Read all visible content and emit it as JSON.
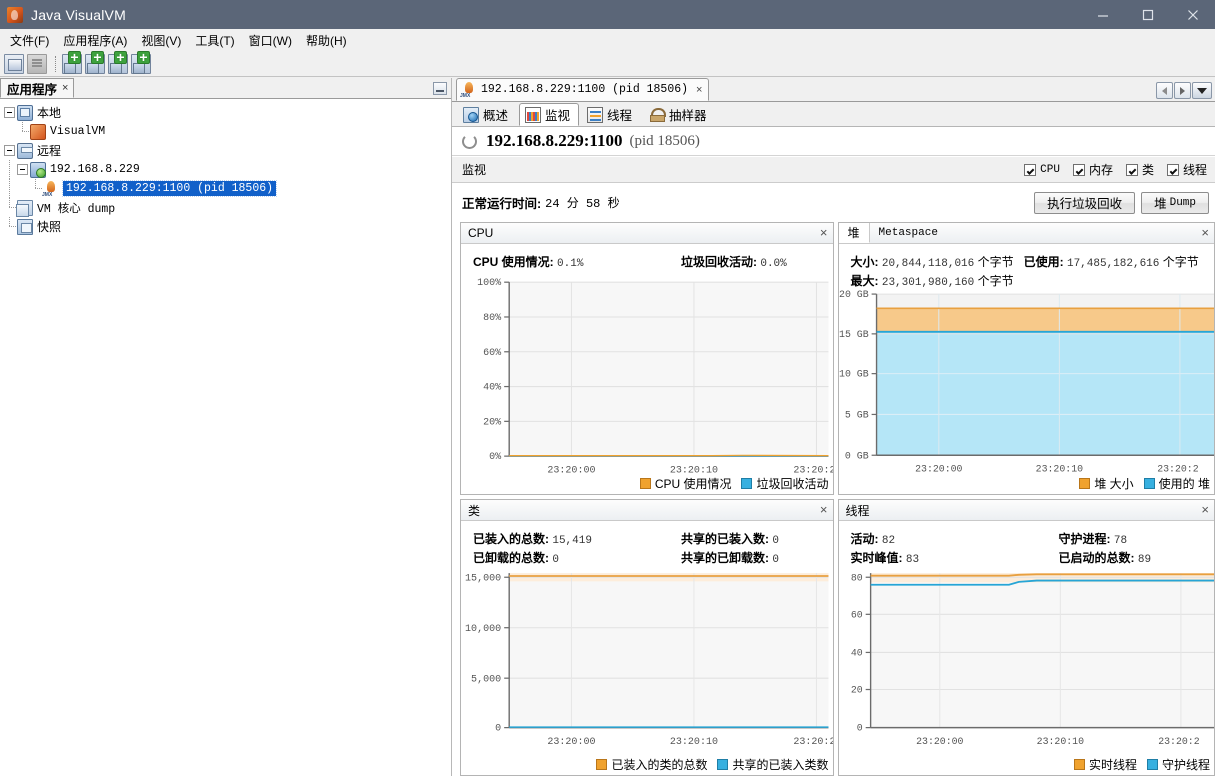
{
  "window": {
    "title": "Java VisualVM",
    "icon": "java-visualvm-icon",
    "minimize": "minimize-icon",
    "maximize": "maximize-icon",
    "close": "close-icon"
  },
  "menubar": {
    "items": [
      {
        "label": "文件(F)"
      },
      {
        "label": "应用程序(A)"
      },
      {
        "label": "视图(V)"
      },
      {
        "label": "工具(T)"
      },
      {
        "label": "窗口(W)"
      },
      {
        "label": "帮助(H)"
      }
    ]
  },
  "toolbar": {
    "buttons": [
      {
        "icon": "open-file-icon"
      },
      {
        "icon": "save-icon"
      },
      {
        "icon": "add-remote-host-icon"
      },
      {
        "icon": "add-jmx-connection-icon"
      },
      {
        "icon": "add-vm-coredump-icon"
      },
      {
        "icon": "add-snapshot-icon"
      }
    ]
  },
  "left_panel": {
    "tab_label": "应用程序",
    "tab_close": "×",
    "minimize_icon": "minimize-panel-icon",
    "tree": [
      {
        "label": "本地",
        "icon": "computer-icon",
        "depth": 0,
        "expanded": true,
        "selected": false,
        "mono": false
      },
      {
        "label": "VisualVM",
        "icon": "visualvm-icon",
        "depth": 1,
        "expanded": null,
        "selected": false,
        "mono": true
      },
      {
        "label": "远程",
        "icon": "remote-icon",
        "depth": 0,
        "expanded": true,
        "selected": false,
        "mono": false
      },
      {
        "label": "192.168.8.229",
        "icon": "host-icon",
        "depth": 1,
        "expanded": true,
        "selected": false,
        "mono": true
      },
      {
        "label": "192.168.8.229:1100 (pid 18506)",
        "icon": "jmx-icon",
        "depth": 2,
        "expanded": null,
        "selected": true,
        "mono": true
      },
      {
        "label": "VM 核心 dump",
        "icon": "vm-coredump-icon",
        "depth": 0,
        "expanded": null,
        "selected": false,
        "mono": false
      },
      {
        "label": "快照",
        "icon": "snapshot-icon",
        "depth": 0,
        "expanded": null,
        "selected": false,
        "mono": false
      }
    ]
  },
  "document_tab": {
    "icon": "jmx-icon",
    "label": "192.168.8.229:1100 (pid 18506)",
    "close": "×",
    "nav": {
      "prev": "chevron-left-icon",
      "next": "chevron-right-icon",
      "list": "chevron-down-icon"
    }
  },
  "subtabs": [
    {
      "label": "概述",
      "icon": "overview-icon",
      "active": false
    },
    {
      "label": "监视",
      "icon": "monitor-icon",
      "active": true
    },
    {
      "label": "线程",
      "icon": "threads-icon",
      "active": false
    },
    {
      "label": "抽样器",
      "icon": "sampler-icon",
      "active": false
    }
  ],
  "app_header": {
    "spinner_icon": "loading-spinner-icon",
    "title": "192.168.8.229:1100",
    "pid": "(pid 18506)"
  },
  "monitor_bar": {
    "label": "监视",
    "checkboxes": [
      {
        "label": "CPU",
        "checked": true,
        "mono": true
      },
      {
        "label": "内存",
        "checked": true,
        "mono": false
      },
      {
        "label": "类",
        "checked": true,
        "mono": false
      },
      {
        "label": "线程",
        "checked": true,
        "mono": false
      }
    ]
  },
  "uptime": {
    "label": "正常运行时间:",
    "value": "24 分 58 秒"
  },
  "actions": {
    "gc_button": "执行垃圾回收",
    "heapdump_button_cn": "堆",
    "heapdump_button_en": "Dump"
  },
  "panels": {
    "cpu": {
      "title": "CPU",
      "close": "×",
      "stats": [
        {
          "label": "CPU 使用情况:",
          "value": "0.1%"
        },
        {
          "label": "垃圾回收活动:",
          "value": "0.0%"
        }
      ],
      "legend": [
        {
          "label": "CPU 使用情况",
          "color": "#f0a22e"
        },
        {
          "label": "垃圾回收活动",
          "color": "#37b0e0"
        }
      ]
    },
    "heap": {
      "tab_active": "堆",
      "tab_inactive": "Metaspace",
      "close": "×",
      "stats": [
        {
          "label": "大小:",
          "value": "20,844,118,016",
          "unit": "个字节"
        },
        {
          "label": "已使用:",
          "value": "17,485,182,616",
          "unit": "个字节"
        },
        {
          "label": "最大:",
          "value": "23,301,980,160",
          "unit": "个字节"
        }
      ],
      "legend": [
        {
          "label": "堆 大小",
          "color": "#f0a22e"
        },
        {
          "label": "使用的 堆",
          "color": "#37b0e0"
        }
      ]
    },
    "classes": {
      "title": "类",
      "close": "×",
      "stats": [
        {
          "label": "已装入的总数:",
          "value": "15,419"
        },
        {
          "label": "共享的已装入数:",
          "value": "0"
        },
        {
          "label": "已卸载的总数:",
          "value": "0"
        },
        {
          "label": "共享的已卸载数:",
          "value": "0"
        }
      ],
      "legend": [
        {
          "label": "已装入的类的总数",
          "color": "#f0a22e"
        },
        {
          "label": "共享的已装入类数",
          "color": "#37b0e0"
        }
      ]
    },
    "threads": {
      "title": "线程",
      "close": "×",
      "stats": [
        {
          "label": "活动:",
          "value": "82"
        },
        {
          "label": "守护进程:",
          "value": "78"
        },
        {
          "label": "实时峰值:",
          "value": "83"
        },
        {
          "label": "已启动的总数:",
          "value": "89"
        }
      ],
      "legend": [
        {
          "label": "实时线程",
          "color": "#f0a22e"
        },
        {
          "label": "守护线程",
          "color": "#37b0e0"
        }
      ]
    }
  },
  "chart_data": [
    {
      "type": "line",
      "id": "cpu-chart",
      "title": "CPU",
      "xlabel": "",
      "ylabel": "",
      "ylim": [
        0,
        100
      ],
      "yticks": [
        "0%",
        "20%",
        "40%",
        "60%",
        "80%",
        "100%"
      ],
      "xticks": [
        "23:20:00",
        "23:20:10",
        "23:20:2"
      ],
      "grid": true,
      "legend_position": "bottom-right",
      "series": [
        {
          "name": "CPU 使用情况",
          "color": "#f0a22e",
          "values": [
            0.1,
            0.1,
            0.1,
            0.1,
            0.1,
            0.1,
            0.1,
            0.1,
            0.1,
            0.1,
            0.1,
            0.1
          ]
        },
        {
          "name": "垃圾回收活动",
          "color": "#37b0e0",
          "values": [
            0.0,
            0.0,
            0.0,
            0.0,
            0.0,
            0.0,
            0.0,
            0.0,
            0.0,
            0.0,
            0.0,
            0.0
          ]
        }
      ]
    },
    {
      "type": "area",
      "id": "heap-chart",
      "title": "堆",
      "xlabel": "",
      "ylabel": "",
      "ylim": [
        0,
        21.7
      ],
      "yticks": [
        "0 GB",
        "5 GB",
        "10 GB",
        "15 GB",
        "20 GB"
      ],
      "xticks": [
        "23:20:00",
        "23:20:10",
        "23:20:2"
      ],
      "grid": true,
      "legend_position": "bottom-right",
      "series": [
        {
          "name": "堆 大小",
          "color": "#f0a22e",
          "values": [
            19.41,
            19.41,
            19.41,
            19.41,
            19.41,
            19.41,
            19.41,
            19.41,
            19.41,
            19.41,
            19.41,
            19.41
          ]
        },
        {
          "name": "使用的 堆",
          "color": "#37b0e0",
          "values": [
            16.28,
            16.28,
            16.28,
            16.28,
            16.28,
            16.28,
            16.28,
            16.28,
            16.28,
            16.28,
            16.28,
            16.28
          ]
        }
      ]
    },
    {
      "type": "line",
      "id": "classes-chart",
      "title": "类",
      "xlabel": "",
      "ylabel": "",
      "ylim": [
        0,
        16300
      ],
      "yticks": [
        "0",
        "5,000",
        "10,000",
        "15,000"
      ],
      "xticks": [
        "23:20:00",
        "23:20:10",
        "23:20:2"
      ],
      "grid": true,
      "legend_position": "bottom-right",
      "series": [
        {
          "name": "已装入的类的总数",
          "color": "#f0a22e",
          "values": [
            15419,
            15419,
            15419,
            15419,
            15419,
            15419,
            15419,
            15419,
            15419,
            15419,
            15419,
            15419
          ]
        },
        {
          "name": "共享的已装入类数",
          "color": "#37b0e0",
          "values": [
            0,
            0,
            0,
            0,
            0,
            0,
            0,
            0,
            0,
            0,
            0,
            0
          ]
        }
      ]
    },
    {
      "type": "line",
      "id": "threads-chart",
      "title": "线程",
      "xlabel": "",
      "ylabel": "",
      "ylim": [
        0,
        87
      ],
      "yticks": [
        "0",
        "20",
        "40",
        "60",
        "80"
      ],
      "xticks": [
        "23:20:00",
        "23:20:10",
        "23:20:2"
      ],
      "grid": true,
      "legend_position": "bottom-right",
      "series": [
        {
          "name": "实时线程",
          "color": "#f0a22e",
          "values": [
            81,
            81,
            81,
            81,
            81,
            81,
            82,
            82,
            82,
            82,
            82,
            82
          ]
        },
        {
          "name": "守护线程",
          "color": "#37b0e0",
          "values": [
            76,
            76,
            76,
            76,
            76,
            76,
            78,
            78,
            78,
            78,
            78,
            78
          ]
        }
      ]
    }
  ]
}
